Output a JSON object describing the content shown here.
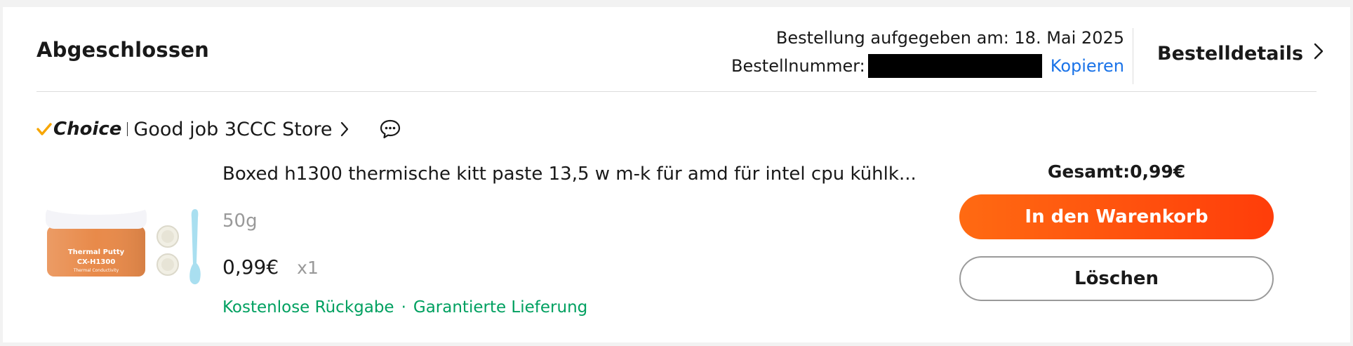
{
  "order": {
    "status": "Abgeschlossen",
    "placed_label": "Bestellung aufgegeben am: 18. Mai 2025",
    "number_label": "Bestellnummer:",
    "copy_label": "Kopieren",
    "details_label": "Bestelldetails"
  },
  "store": {
    "badge": "Choice",
    "name": "Good job 3CCC Store"
  },
  "product": {
    "title": "Boxed h1300 thermische kitt paste 13,5 w m-k für amd für intel cpu kühlk...",
    "variant": "50g",
    "price": "0,99€",
    "quantity": "x1",
    "tags": [
      "Kostenlose Rückgabe",
      "·",
      "Garantierte Lieferung"
    ],
    "image_text": {
      "line1": "Thermal Putty",
      "line2": "CX-H1300",
      "line3": "Thermal Conductivity"
    }
  },
  "summary": {
    "total": "Gesamt:0,99€"
  },
  "actions": {
    "cart_label": "In den Warenkorb",
    "delete_label": "Löschen"
  },
  "colors": {
    "accent": "#ff4d0f",
    "link": "#1a73e8",
    "success": "#00a060",
    "badge_check": "#f7a600"
  },
  "icons": {
    "details": "chevron-right-icon",
    "store": "chevron-right-icon",
    "chat": "chat-bubble-icon",
    "choice": "checkmark-icon"
  }
}
